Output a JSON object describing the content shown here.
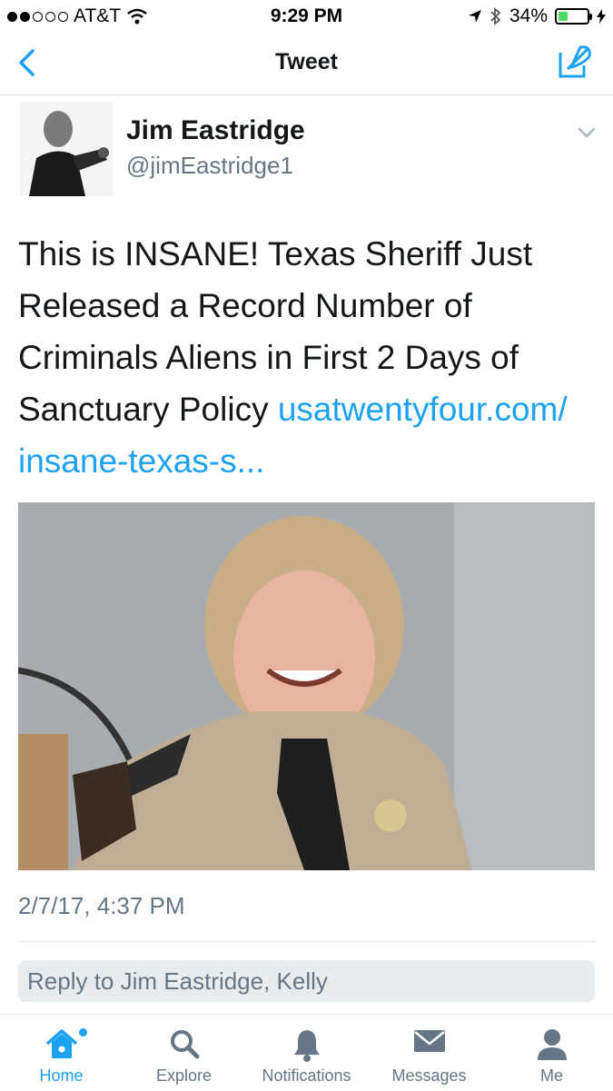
{
  "status_bar": {
    "carrier": "AT&T",
    "time": "9:29 PM",
    "battery": "34%",
    "battery_level": 0.34
  },
  "nav": {
    "title": "Tweet"
  },
  "tweet": {
    "name": "Jim Eastridge",
    "handle": "@jimEastridge1",
    "text": "This is INSANE! Texas Sheriff Just Released a Record Number of Criminals Aliens in First 2 Days of Sanctuary Policy ",
    "link": "usatwentyfour.com/ insane-texas-s...",
    "timestamp": "2/7/17, 4:37 PM"
  },
  "reply": {
    "placeholder": "Reply to Jim Eastridge, Kelly"
  },
  "tabs": [
    {
      "label": "Home",
      "icon": "home-icon"
    },
    {
      "label": "Explore",
      "icon": "search-icon"
    },
    {
      "label": "Notifications",
      "icon": "bell-icon"
    },
    {
      "label": "Messages",
      "icon": "envelope-icon"
    },
    {
      "label": "Me",
      "icon": "person-icon"
    }
  ],
  "colors": {
    "accent": "#1da1f2",
    "secondary_text": "#657786",
    "text": "#14171a",
    "battery": "#4cd964"
  }
}
